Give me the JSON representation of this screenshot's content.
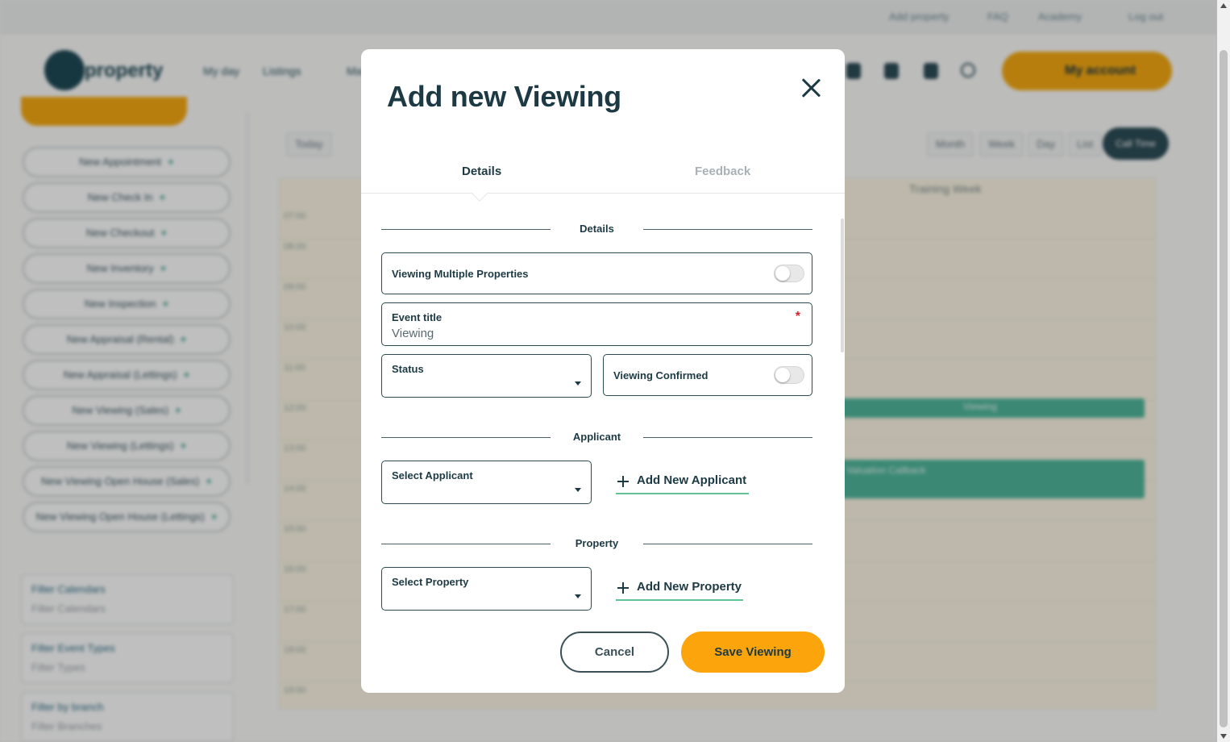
{
  "background": {
    "top_links": [
      "Add property",
      "FAQ",
      "Academy",
      "Log out"
    ],
    "logo_text": "property",
    "nav_items": [
      "My day",
      "Listings",
      "Ma"
    ],
    "account_label": "My account",
    "side_pills": [
      "New Appointment",
      "New Check In",
      "New Checkout",
      "New Inventory",
      "New Inspection",
      "New Appraisal (Rental)",
      "New Appraisal (Lettings)",
      "New Viewing (Sales)",
      "New Viewing (Lettings)",
      "New Viewing Open House (Sales)",
      "New Viewing Open House (Lettings)"
    ],
    "filters": [
      {
        "label": "Filter Calendars",
        "value": "Filter Calendars"
      },
      {
        "label": "Filter Event Types",
        "value": "Filter Types"
      },
      {
        "label": "Filter by branch",
        "value": "Filter Branches"
      }
    ],
    "calendar_buttons": [
      "Today",
      "Month",
      "Week",
      "Day",
      "List"
    ],
    "today_label": "Call Time",
    "calendar_header": "Training Week",
    "times": [
      "07:00",
      "08:00",
      "09:00",
      "10:00",
      "11:00",
      "12:00",
      "13:00",
      "14:00",
      "15:00",
      "16:00",
      "17:00",
      "18:00",
      "19:00"
    ],
    "event_1": "Viewing",
    "event_2": "Valuation Callback"
  },
  "modal": {
    "title": "Add new Viewing",
    "tabs": {
      "details": "Details",
      "feedback": "Feedback"
    },
    "sections": {
      "details": "Details",
      "applicant": "Applicant",
      "property": "Property"
    },
    "viewing_multiple": {
      "label": "Viewing Multiple Properties",
      "on": false
    },
    "event_title": {
      "label": "Event title",
      "value": "Viewing",
      "required_mark": "*"
    },
    "status": {
      "label": "Status",
      "value": ""
    },
    "viewing_confirmed": {
      "label": "Viewing Confirmed",
      "on": false
    },
    "select_applicant": {
      "label": "Select Applicant",
      "value": ""
    },
    "add_applicant": "Add New Applicant",
    "select_property": {
      "label": "Select Property",
      "value": ""
    },
    "add_property": "Add New Property",
    "cancel": "Cancel",
    "save": "Save Viewing"
  },
  "colors": {
    "accent": "#fca40c",
    "primary_text": "#1d3a44",
    "link_underline": "#5fc393",
    "required": "#d61f2c"
  }
}
